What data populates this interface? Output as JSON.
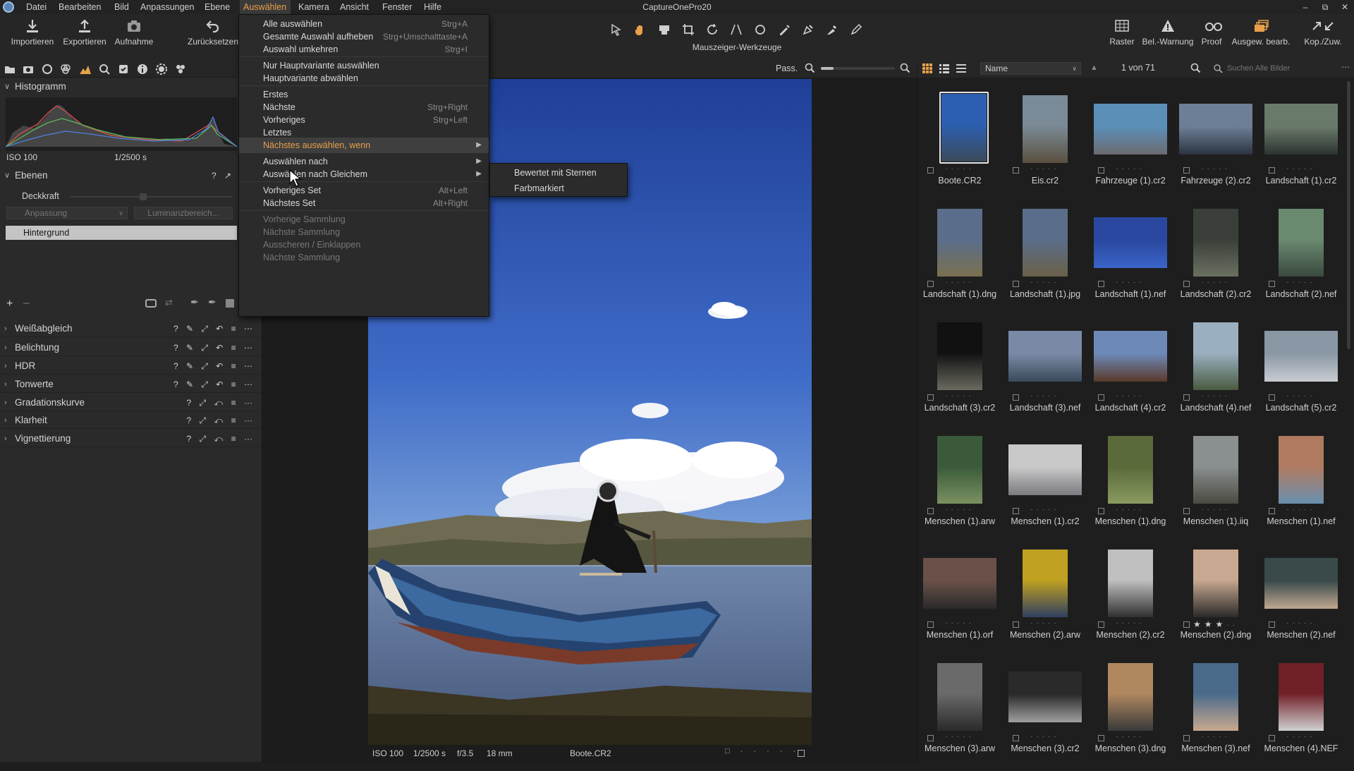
{
  "app": {
    "title": "CaptureOnePro20"
  },
  "menubar": {
    "items": [
      "Datei",
      "Bearbeiten",
      "Bild",
      "Anpassungen",
      "Ebene",
      "Auswählen",
      "Kamera",
      "Ansicht",
      "Fenster",
      "Hilfe"
    ]
  },
  "toolbar": {
    "left": [
      "Importieren",
      "Exportieren",
      "Aufnahme",
      "Zurücksetzen"
    ],
    "cursor_tools_label": "Mauszeiger-Werkzeuge",
    "right": [
      "Raster",
      "Bel.-Warnung",
      "Proof",
      "Ausgew. bearb.",
      "Kop./Zuw."
    ]
  },
  "histogram": {
    "title": "Histogramm",
    "iso": "ISO 100",
    "shutter": "1/2500 s"
  },
  "layers": {
    "title": "Ebenen",
    "opacity_label": "Deckkraft",
    "adjust_select": "Anpassung",
    "luminance_button": "Luminanzbereich...",
    "layer_name": "Hintergrund"
  },
  "tool_sections": [
    "Weißabgleich",
    "Belichtung",
    "HDR",
    "Tonwerte",
    "Gradationskurve",
    "Klarheit",
    "Vignettierung"
  ],
  "viewer": {
    "fit_label": "Pass.",
    "info": {
      "iso": "ISO 100",
      "shutter": "1/2500 s",
      "aperture": "f/3.5",
      "focal": "18 mm",
      "filename": "Boote.CR2"
    }
  },
  "browser": {
    "sort_label": "Name",
    "counter": "1 von 71",
    "search_placeholder": "Suchen Alle Bilder",
    "thumbnails": [
      {
        "name": "Boote.CR2",
        "stars": 0
      },
      {
        "name": "Eis.cr2",
        "stars": 0
      },
      {
        "name": "Fahrzeuge (1).cr2",
        "stars": 0
      },
      {
        "name": "Fahrzeuge (2).cr2",
        "stars": 0
      },
      {
        "name": "Landschaft (1).cr2",
        "stars": 0
      },
      {
        "name": "Landschaft (1).dng",
        "stars": 0
      },
      {
        "name": "Landschaft (1).jpg",
        "stars": 0
      },
      {
        "name": "Landschaft (1).nef",
        "stars": 0
      },
      {
        "name": "Landschaft (2).cr2",
        "stars": 0
      },
      {
        "name": "Landschaft (2).nef",
        "stars": 0
      },
      {
        "name": "Landschaft (3).cr2",
        "stars": 0
      },
      {
        "name": "Landschaft (3).nef",
        "stars": 0
      },
      {
        "name": "Landschaft (4).cr2",
        "stars": 0
      },
      {
        "name": "Landschaft (4).nef",
        "stars": 0
      },
      {
        "name": "Landschaft (5).cr2",
        "stars": 0
      },
      {
        "name": "Menschen (1).arw",
        "stars": 0
      },
      {
        "name": "Menschen (1).cr2",
        "stars": 0
      },
      {
        "name": "Menschen (1).dng",
        "stars": 0
      },
      {
        "name": "Menschen (1).iiq",
        "stars": 0
      },
      {
        "name": "Menschen (1).nef",
        "stars": 0
      },
      {
        "name": "Menschen (1).orf",
        "stars": 0
      },
      {
        "name": "Menschen (2).arw",
        "stars": 0
      },
      {
        "name": "Menschen (2).cr2",
        "stars": 0
      },
      {
        "name": "Menschen (2).dng",
        "stars": 3
      },
      {
        "name": "Menschen (2).nef",
        "stars": 0
      },
      {
        "name": "Menschen (3).arw",
        "stars": 0
      },
      {
        "name": "Menschen (3).cr2",
        "stars": 0
      },
      {
        "name": "Menschen (3).dng",
        "stars": 0
      },
      {
        "name": "Menschen (3).nef",
        "stars": 0
      },
      {
        "name": "Menschen (4).NEF",
        "stars": 0
      }
    ]
  },
  "menu": {
    "items": [
      {
        "label": "Alle auswählen",
        "shortcut": "Strg+A"
      },
      {
        "label": "Gesamte Auswahl aufheben",
        "shortcut": "Strg+Umschalttaste+A"
      },
      {
        "label": "Auswahl umkehren",
        "shortcut": "Strg+I"
      },
      {
        "label": "Nur Hauptvariante auswählen",
        "shortcut": ""
      },
      {
        "label": "Hauptvariante abwählen",
        "shortcut": ""
      },
      {
        "label": "Erstes",
        "shortcut": ""
      },
      {
        "label": "Nächste",
        "shortcut": "Strg+Right"
      },
      {
        "label": "Vorheriges",
        "shortcut": "Strg+Left"
      },
      {
        "label": "Letztes",
        "shortcut": ""
      },
      {
        "label": "Nächstes auswählen, wenn",
        "shortcut": ""
      },
      {
        "label": "Auswählen nach",
        "shortcut": ""
      },
      {
        "label": "Auswählen nach Gleichem",
        "shortcut": ""
      },
      {
        "label": "Vorheriges Set",
        "shortcut": "Alt+Left"
      },
      {
        "label": "Nächstes Set",
        "shortcut": "Alt+Right"
      },
      {
        "label": "Vorherige Sammlung",
        "shortcut": ""
      },
      {
        "label": "Nächste Sammlung",
        "shortcut": ""
      },
      {
        "label": "Ausscheren / Einklappen",
        "shortcut": ""
      },
      {
        "label": "Nächste Sammlung",
        "shortcut": ""
      }
    ],
    "submenu": [
      "Bewertet mit Sternen",
      "Farbmarkiert"
    ]
  },
  "colors": {
    "accent": "#e8a04a",
    "panel": "#2a2a2a",
    "background": "#1e1e1e"
  }
}
